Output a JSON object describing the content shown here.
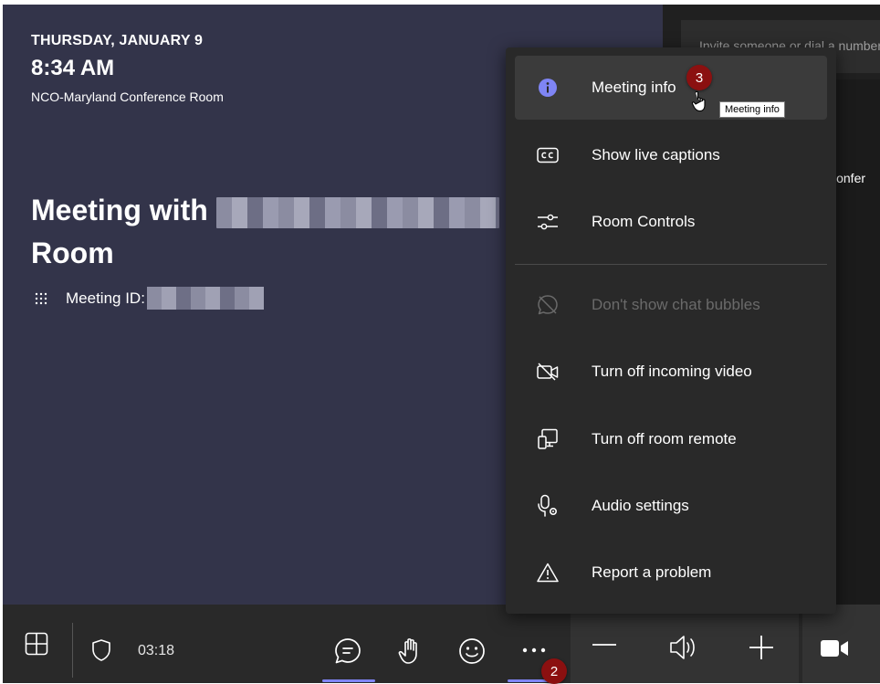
{
  "stage": {
    "date": "THURSDAY, JANUARY 9",
    "time": "8:34 AM",
    "room": "NCO-Maryland Conference Room",
    "title_prefix": "Meeting with",
    "title_suffix": "Room",
    "meeting_id_label": "Meeting ID:"
  },
  "side_panel": {
    "invite_placeholder": "Invite someone or dial a number",
    "participant_partial": "Confer"
  },
  "toolbar": {
    "timer": "03:18",
    "buttons": [
      "layout-icon",
      "shield-icon",
      "chat-icon",
      "raise-hand-icon",
      "reactions-icon",
      "more-icon",
      "volume-down-icon",
      "speaker-icon",
      "volume-up-icon",
      "camera-icon"
    ]
  },
  "menu": {
    "items": [
      {
        "label": "Meeting info",
        "icon": "info-icon",
        "state": "hover"
      },
      {
        "label": "Show live captions",
        "icon": "captions-icon",
        "state": "normal"
      },
      {
        "label": "Room Controls",
        "icon": "sliders-icon",
        "state": "normal"
      },
      {
        "label": "Don't show chat bubbles",
        "icon": "chat-bubble-off-icon",
        "state": "disabled"
      },
      {
        "label": "Turn off incoming video",
        "icon": "video-off-icon",
        "state": "normal"
      },
      {
        "label": "Turn off room remote",
        "icon": "remote-icon",
        "state": "normal"
      },
      {
        "label": "Audio settings",
        "icon": "mic-settings-icon",
        "state": "normal"
      },
      {
        "label": "Report a problem",
        "icon": "warning-icon",
        "state": "normal"
      }
    ]
  },
  "tooltip": "Meeting info",
  "annotations": {
    "step_2": "2",
    "step_3": "3"
  },
  "colors": {
    "stage": "#33344a",
    "accent": "#7f85f5",
    "badge": "#8b1010",
    "menu_bg": "#292929"
  }
}
